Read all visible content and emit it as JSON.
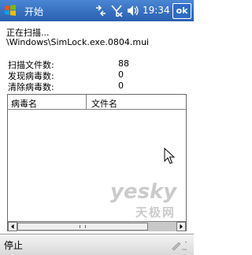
{
  "titlebar": {
    "app_title": "开始",
    "clock": "19:34",
    "ok_label": "ok",
    "status_icons": [
      "connectivity-icon",
      "no-signal-icon",
      "volume-icon"
    ]
  },
  "scan": {
    "status": "正在扫描...",
    "path": "\\Windows\\SimLock.exe.0804.mui",
    "files_label": "扫描文件数:",
    "files_value": "88",
    "found_label": "发现病毒数:",
    "found_value": "0",
    "cleared_label": "清除病毒数:",
    "cleared_value": "0"
  },
  "list": {
    "columns": [
      "病毒名",
      "文件名"
    ],
    "rows": []
  },
  "menubar": {
    "left_softkey": "停止"
  },
  "watermark": {
    "line1": "yesky",
    "line2": "天极网"
  },
  "colors": {
    "titlebar": "#2a5fb0",
    "menubar": "#d9d9d9"
  }
}
